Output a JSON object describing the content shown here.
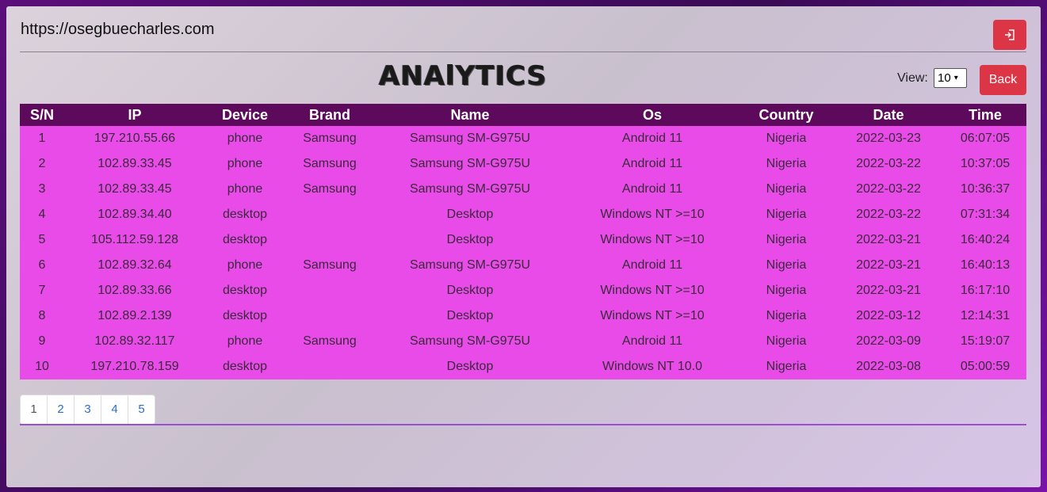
{
  "header": {
    "site_url": "https://osegbuecharles.com"
  },
  "title": "ANAlYTICS",
  "view": {
    "label": "View:",
    "selected": "10"
  },
  "back_label": "Back",
  "table": {
    "columns": [
      "S/N",
      "IP",
      "Device",
      "Brand",
      "Name",
      "Os",
      "Country",
      "Date",
      "Time"
    ],
    "rows": [
      [
        "1",
        "197.210.55.66",
        "phone",
        "Samsung",
        "Samsung SM-G975U",
        "Android 11",
        "Nigeria",
        "2022-03-23",
        "06:07:05"
      ],
      [
        "2",
        "102.89.33.45",
        "phone",
        "Samsung",
        "Samsung SM-G975U",
        "Android 11",
        "Nigeria",
        "2022-03-22",
        "10:37:05"
      ],
      [
        "3",
        "102.89.33.45",
        "phone",
        "Samsung",
        "Samsung SM-G975U",
        "Android 11",
        "Nigeria",
        "2022-03-22",
        "10:36:37"
      ],
      [
        "4",
        "102.89.34.40",
        "desktop",
        "",
        "Desktop",
        "Windows NT >=10",
        "Nigeria",
        "2022-03-22",
        "07:31:34"
      ],
      [
        "5",
        "105.112.59.128",
        "desktop",
        "",
        "Desktop",
        "Windows NT >=10",
        "Nigeria",
        "2022-03-21",
        "16:40:24"
      ],
      [
        "6",
        "102.89.32.64",
        "phone",
        "Samsung",
        "Samsung SM-G975U",
        "Android 11",
        "Nigeria",
        "2022-03-21",
        "16:40:13"
      ],
      [
        "7",
        "102.89.33.66",
        "desktop",
        "",
        "Desktop",
        "Windows NT >=10",
        "Nigeria",
        "2022-03-21",
        "16:17:10"
      ],
      [
        "8",
        "102.89.2.139",
        "desktop",
        "",
        "Desktop",
        "Windows NT >=10",
        "Nigeria",
        "2022-03-12",
        "12:14:31"
      ],
      [
        "9",
        "102.89.32.117",
        "phone",
        "Samsung",
        "Samsung SM-G975U",
        "Android 11",
        "Nigeria",
        "2022-03-09",
        "15:19:07"
      ],
      [
        "10",
        "197.210.78.159",
        "desktop",
        "",
        "Desktop",
        "Windows NT 10.0",
        "Nigeria",
        "2022-03-08",
        "05:00:59"
      ]
    ]
  },
  "pagination": [
    "1",
    "2",
    "3",
    "4",
    "5"
  ],
  "icons": {
    "logout": "sign-out-icon",
    "select_caret": "chevron-down-icon"
  },
  "colors": {
    "danger": "#dc3545",
    "table_header": "#5e0a5c",
    "table_row": "#e84be8",
    "link": "#2a6fc9"
  }
}
